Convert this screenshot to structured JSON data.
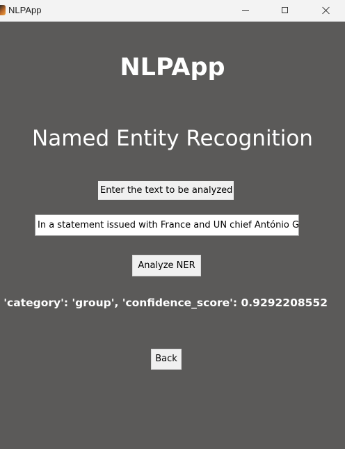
{
  "window": {
    "title": "NLPApp"
  },
  "titlebar": {
    "controls": [
      "minimize-icon",
      "maximize-icon",
      "close-icon"
    ]
  },
  "main": {
    "app_heading": "NLPApp",
    "page_heading": "Named Entity Recognition",
    "prompt_label": "Enter the text to be analyzed",
    "input_value": "In a statement issued with France and UN chief António G",
    "analyze_button": "Analyze NER",
    "result_text": ", 'category': 'group', 'confidence_score': 0.9292208552",
    "back_button": "Back"
  },
  "colors": {
    "background": "#5b5a59",
    "heading_text": "#ffffff",
    "button_face": "#f0f0f0",
    "titlebar": "#f3f3f3"
  }
}
